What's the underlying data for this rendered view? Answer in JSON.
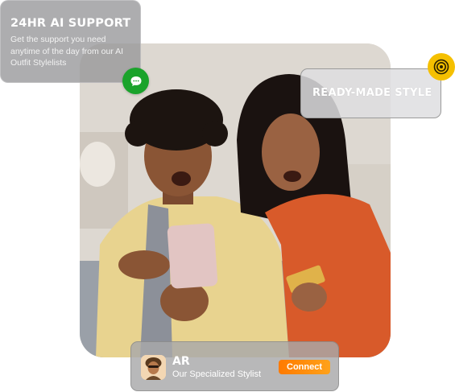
{
  "support": {
    "title": "24HR AI SUPPORT",
    "description": "Get the support you need anytime of the day from our AI Outfit Stylelists",
    "chat_icon": "chat-bubble-icon",
    "accent": "#1aa32b"
  },
  "ready_made": {
    "label": "READY-MADE STYLE",
    "badge_icon": "target-icon",
    "accent": "#f5c000"
  },
  "stylist": {
    "initials": "AR",
    "role": "Our Specialized Stylist",
    "connect_label": "Connect",
    "avatar_icon": "stylist-avatar-icon",
    "accent": "#ff8a00"
  },
  "photo": {
    "subject": "hero-photo"
  }
}
